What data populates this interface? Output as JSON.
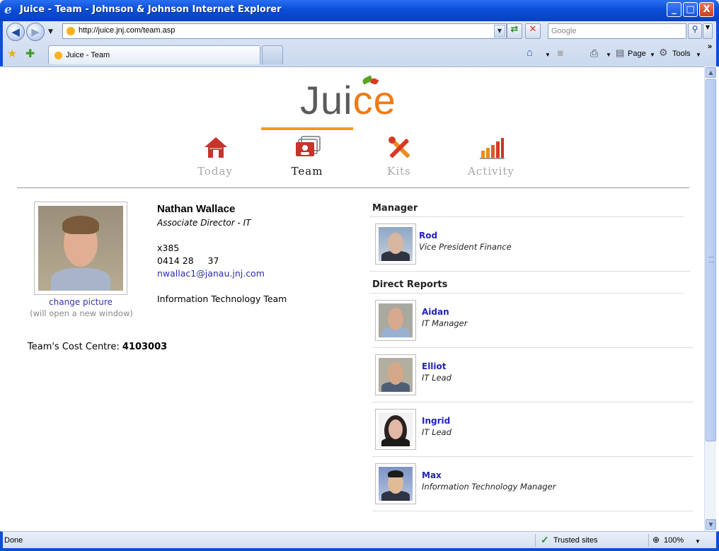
{
  "window": {
    "title": "Juice - Team - Johnson & Johnson Internet Explorer",
    "min": "_",
    "max": "□",
    "close": "X"
  },
  "browser": {
    "back": "◀",
    "forward": "▶",
    "url": "http://juice.jnj.com/team.asp",
    "search_placeholder": "Google",
    "tab_label": "Juice - Team",
    "tools": {
      "page": "Page",
      "tools": "Tools"
    }
  },
  "page": {
    "logo": {
      "j": "Ju",
      "i": "i",
      "ce": "ce"
    },
    "nav": [
      {
        "label": "Today",
        "active": false
      },
      {
        "label": "Team",
        "active": true
      },
      {
        "label": "Kits",
        "active": false
      },
      {
        "label": "Activity",
        "active": false
      }
    ],
    "profile": {
      "name": "Nathan Wallace",
      "title": "Associate Director - IT",
      "extension": "x385",
      "mobile": "0414 28     37",
      "email": "nwallac1@janau.jnj.com",
      "team": "Information Technology Team",
      "change_picture": "change picture",
      "picture_note": "(will open a new window)",
      "cost_centre_label": "Team's Cost Centre: ",
      "cost_centre_value": "4103003"
    },
    "manager_header": "Manager",
    "manager": {
      "name": "Rod",
      "role": "Vice President Finance"
    },
    "reports_header": "Direct Reports",
    "reports": [
      {
        "name": "Aidan",
        "role": "IT Manager"
      },
      {
        "name": "Elliot",
        "role": "IT Lead"
      },
      {
        "name": "Ingrid",
        "role": "IT Lead"
      },
      {
        "name": "Max",
        "role": "Information Technology Manager"
      }
    ]
  },
  "status": {
    "left": "Done",
    "zone": "Trusted sites",
    "zoom": "100%"
  }
}
